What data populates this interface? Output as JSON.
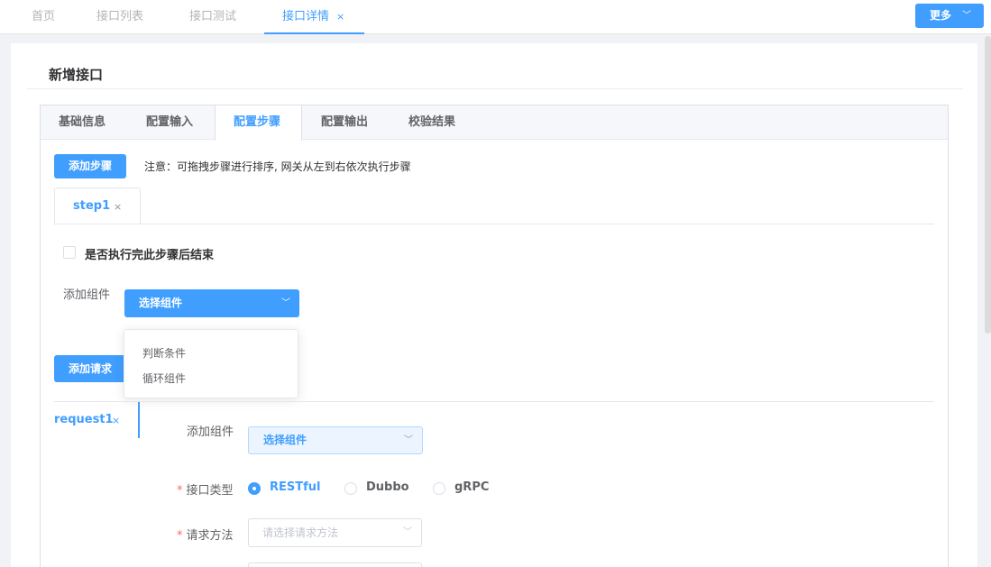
{
  "top_tabs": {
    "home": "首页",
    "api_list": "接口列表",
    "api_test": "接口测试",
    "api_detail": "接口详情",
    "close": "×"
  },
  "more_button": {
    "label": "更多",
    "chevron": "﹀"
  },
  "page": {
    "title": "新增接口"
  },
  "main_tabs": [
    "基础信息",
    "配置输入",
    "配置步骤",
    "配置输出",
    "校验结果"
  ],
  "add_step_button": "添加步骤",
  "note": "注意：可拖拽步骤进行排序, 网关从左到右依次执行步骤",
  "step_tab": {
    "label": "step1",
    "close": "×"
  },
  "end_after_step_label": "是否执行完此步骤后结束",
  "add_component_label": "添加组件",
  "component_select": {
    "value": "选择组件",
    "chevron": "﹀"
  },
  "component_dropdown": [
    "判断条件",
    "循环组件"
  ],
  "add_request_button": "添加请求",
  "request_tab": {
    "label": "request1",
    "close": "×"
  },
  "request_form": {
    "add_component_label": "添加组件",
    "component_select_value": "选择组件",
    "chevron": "﹀",
    "api_type_label": "接口类型",
    "api_type_options": [
      "RESTful",
      "Dubbo",
      "gRPC"
    ],
    "api_type_selected": "RESTful",
    "method_label": "请求方法",
    "method_placeholder": "请选择请求方法",
    "required_mark": "*"
  },
  "colors": {
    "primary": "#409eff",
    "required": "#f56c6c"
  }
}
